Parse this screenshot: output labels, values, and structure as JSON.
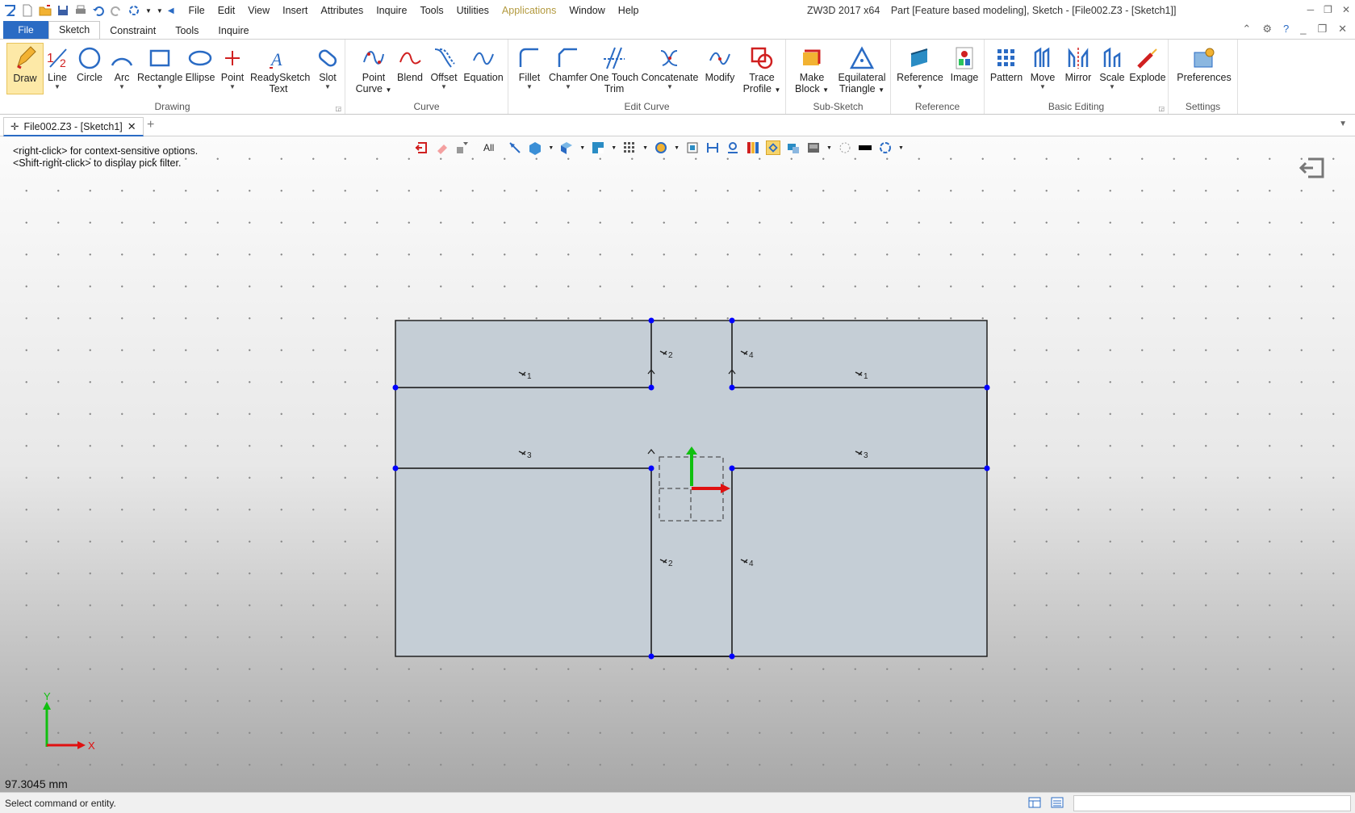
{
  "menu": {
    "items": [
      "File",
      "Edit",
      "View",
      "Insert",
      "Attributes",
      "Inquire",
      "Tools",
      "Utilities",
      "Applications",
      "Window",
      "Help"
    ]
  },
  "app_title": {
    "product": "ZW3D 2017  x64",
    "document": "Part [Feature based modeling],  Sketch - [File002.Z3 - [Sketch1]]"
  },
  "ribbon_tabs": {
    "file": "File",
    "tabs": [
      "Sketch",
      "Constraint",
      "Tools",
      "Inquire"
    ]
  },
  "ribbon": {
    "groups": {
      "drawing": "Drawing",
      "curve": "Curve",
      "edit_curve": "Edit Curve",
      "sub_sketch": "Sub-Sketch",
      "reference": "Reference",
      "basic_editing": "Basic Editing",
      "settings": "Settings"
    },
    "tools": {
      "draw": "Draw",
      "line": "Line",
      "circle": "Circle",
      "arc": "Arc",
      "rectangle": "Rectangle",
      "ellipse": "Ellipse",
      "point": "Point",
      "readysketch_1": "ReadySketch",
      "readysketch_2": "Text",
      "slot": "Slot",
      "point_curve_1": "Point",
      "point_curve_2": "Curve",
      "blend": "Blend",
      "offset": "Offset",
      "equation": "Equation",
      "fillet": "Fillet",
      "chamfer": "Chamfer",
      "one_touch_1": "One Touch",
      "one_touch_2": "Trim",
      "concatenate": "Concatenate",
      "modify": "Modify",
      "trace_1": "Trace",
      "trace_2": "Profile",
      "make_block_1": "Make",
      "make_block_2": "Block",
      "eq_tri_1": "Equilateral",
      "eq_tri_2": "Triangle",
      "reference": "Reference",
      "image": "Image",
      "pattern": "Pattern",
      "move": "Move",
      "mirror": "Mirror",
      "scale": "Scale",
      "explode": "Explode",
      "preferences": "Preferences"
    }
  },
  "doc_tab": {
    "title": "File002.Z3 - [Sketch1]"
  },
  "viewport": {
    "filter_label": "All",
    "hint_1": "<right-click> for context-sensitive options.",
    "hint_2": "<Shift-right-click> to display pick filter.",
    "measure": "97.3045 mm",
    "axis_x": "X",
    "axis_y": "Y",
    "constraint_labels": [
      "1",
      "2",
      "4",
      "1",
      "3",
      "3",
      "2",
      "4"
    ]
  },
  "status": {
    "text": "Select command or entity."
  },
  "colors": {
    "accent": "#2a6bc4",
    "sketch_fill": "#c5ced6",
    "point": "#0000ff",
    "axis_x": "#e01010",
    "axis_y": "#10c010"
  }
}
